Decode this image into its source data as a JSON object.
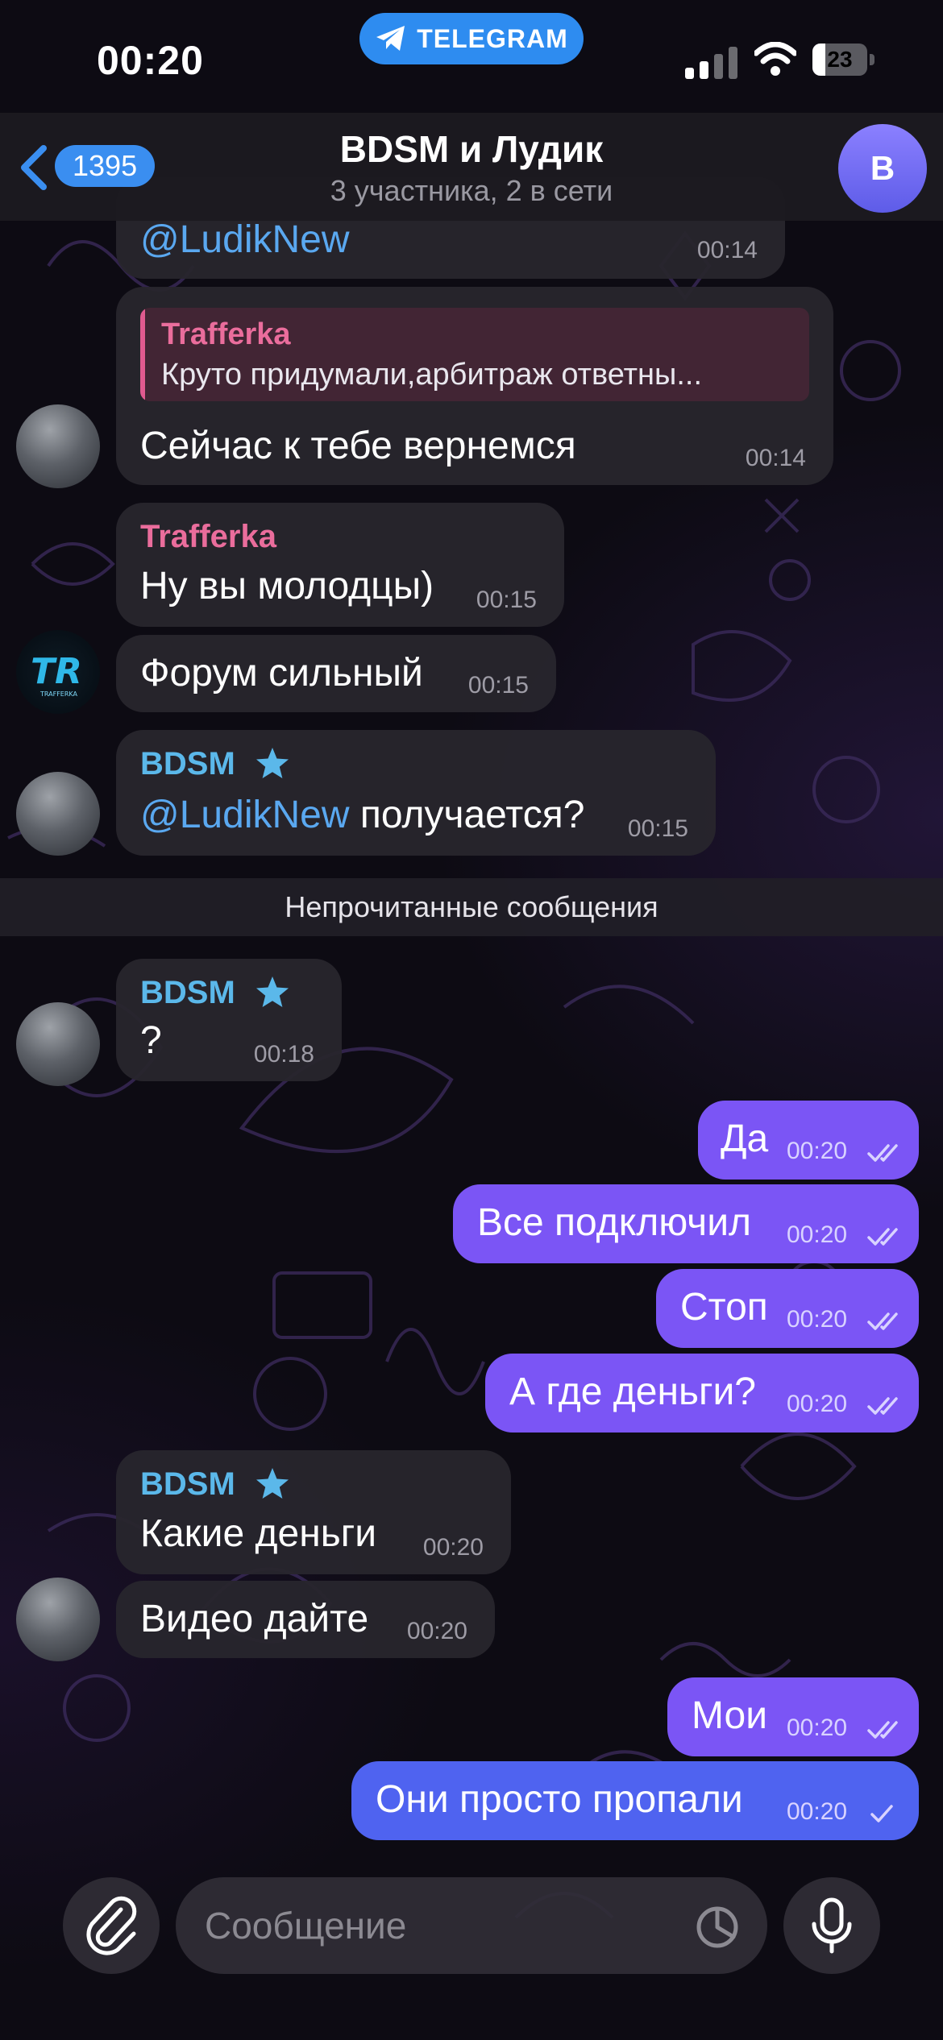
{
  "status_bar": {
    "time": "00:20",
    "pill_label": "TELEGRAM",
    "battery_percent": "23",
    "battery_level": 0.23,
    "icons": [
      "telegram-plane-icon",
      "signal-icon",
      "wifi-icon",
      "battery-icon"
    ]
  },
  "header": {
    "back_count": "1395",
    "title": "BDSM и Лудик",
    "subtitle": "3 участника, 2 в сети",
    "avatar_letter": "B"
  },
  "messages": {
    "m1": {
      "text": "@LudikNew",
      "time": "00:14"
    },
    "m2": {
      "reply_name": "Trafferka",
      "reply_text": "Круто придумали,арбитраж ответны...",
      "text": "Сейчас к тебе вернемся",
      "time": "00:14"
    },
    "m3": {
      "sender": "Trafferka",
      "text": "Ну вы молодцы)",
      "time": "00:15"
    },
    "m4": {
      "text": "Форум сильный",
      "time": "00:15"
    },
    "m5": {
      "sender": "BDSM",
      "mention": "@LudikNew",
      "text": " получается?",
      "time": "00:15"
    },
    "unread_label": "Непрочитанные сообщения",
    "m6": {
      "sender": "BDSM",
      "text": "?",
      "time": "00:18"
    },
    "o1": {
      "text": "Да",
      "time": "00:20"
    },
    "o2": {
      "text": "Все подключил",
      "time": "00:20"
    },
    "o3": {
      "text": "Стоп",
      "time": "00:20"
    },
    "o4": {
      "text": "А где деньги?",
      "time": "00:20"
    },
    "m7": {
      "sender": "BDSM",
      "text": "Какие деньги",
      "time": "00:20"
    },
    "m8": {
      "text": "Видео дайте",
      "time": "00:20"
    },
    "o5": {
      "text": "Мои",
      "time": "00:20"
    },
    "o6": {
      "text": "Они просто пропали",
      "time": "00:20"
    }
  },
  "composer": {
    "placeholder": "Сообщение"
  },
  "colors": {
    "outgoing": "#7b55f5",
    "outgoing_last": "#4f63f0",
    "incoming": "#28252d",
    "accent": "#3a8ef0",
    "sender_pink": "#ea6d9c",
    "sender_cyan": "#5bb8ea"
  }
}
